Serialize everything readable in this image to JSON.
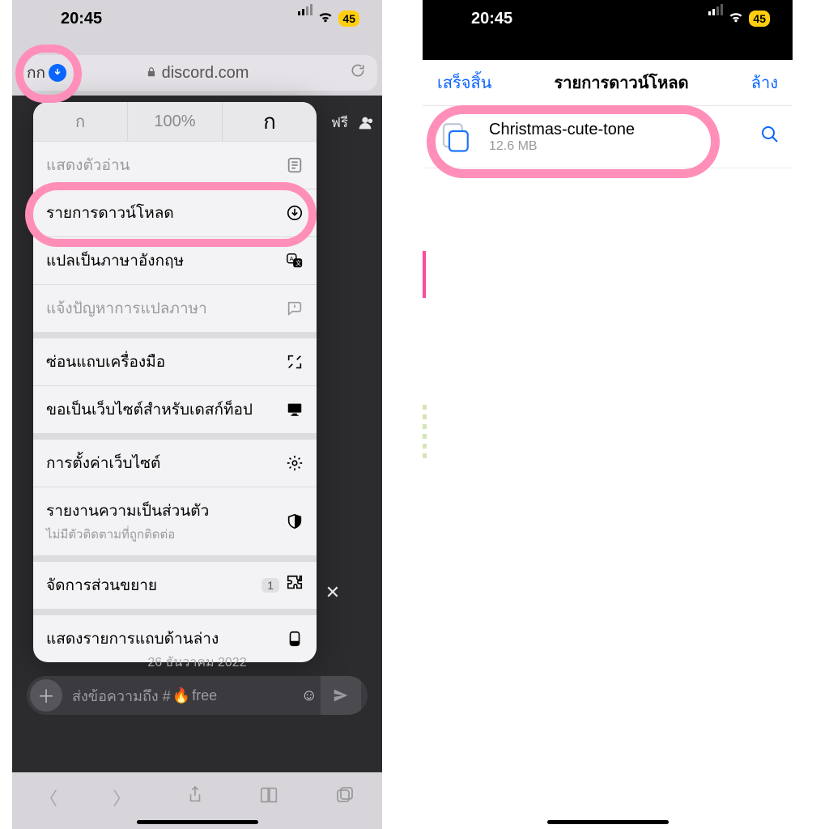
{
  "status": {
    "time": "20:45",
    "battery": "45"
  },
  "left": {
    "address_aa": "กก",
    "url_text": "discord.com",
    "behind_text": "ฟรี",
    "menu": {
      "zoom": "100%",
      "small_a": "ก",
      "big_a": "ก",
      "items": [
        {
          "label": "แสดงตัวอ่าน",
          "icon": "reader-icon",
          "muted": true
        },
        {
          "label": "รายการดาวน์โหลด",
          "icon": "download-circle-icon"
        },
        {
          "label": "แปลเป็นภาษาอังกฤษ",
          "icon": "translate-icon"
        },
        {
          "label": "แจ้งปัญหาการแปลภาษา",
          "icon": "report-icon",
          "muted": true
        },
        {
          "label": "ซ่อนแถบเครื่องมือ",
          "icon": "fullscreen-icon",
          "g": true
        },
        {
          "label": "ขอเป็นเว็บไซต์สำหรับเดสก์ท็อป",
          "icon": "desktop-icon"
        },
        {
          "label": "การตั้งค่าเว็บไซต์",
          "icon": "gear-icon",
          "g": true
        },
        {
          "label": "รายงานความเป็นส่วนตัว",
          "icon": "shield-icon",
          "sub": "ไม่มีตัวติดตามที่ถูกติดต่อ"
        },
        {
          "label": "จัดการส่วนขยาย",
          "icon": "puzzle-icon",
          "badge": "1",
          "g": true
        },
        {
          "label": "แสดงรายการแถบด้านล่าง",
          "icon": "tabbar-bottom-icon",
          "g": true
        }
      ]
    },
    "date_label": "26 ธันวาคม 2022",
    "compose_prefix": "ส่งข้อความถึง #",
    "compose_channel": "free"
  },
  "right": {
    "done": "เสร็จสิ้น",
    "title": "รายการดาวน์โหลด",
    "clear": "ล้าง",
    "file": {
      "name": "Christmas-cute-tone",
      "size": "12.6 MB"
    }
  }
}
